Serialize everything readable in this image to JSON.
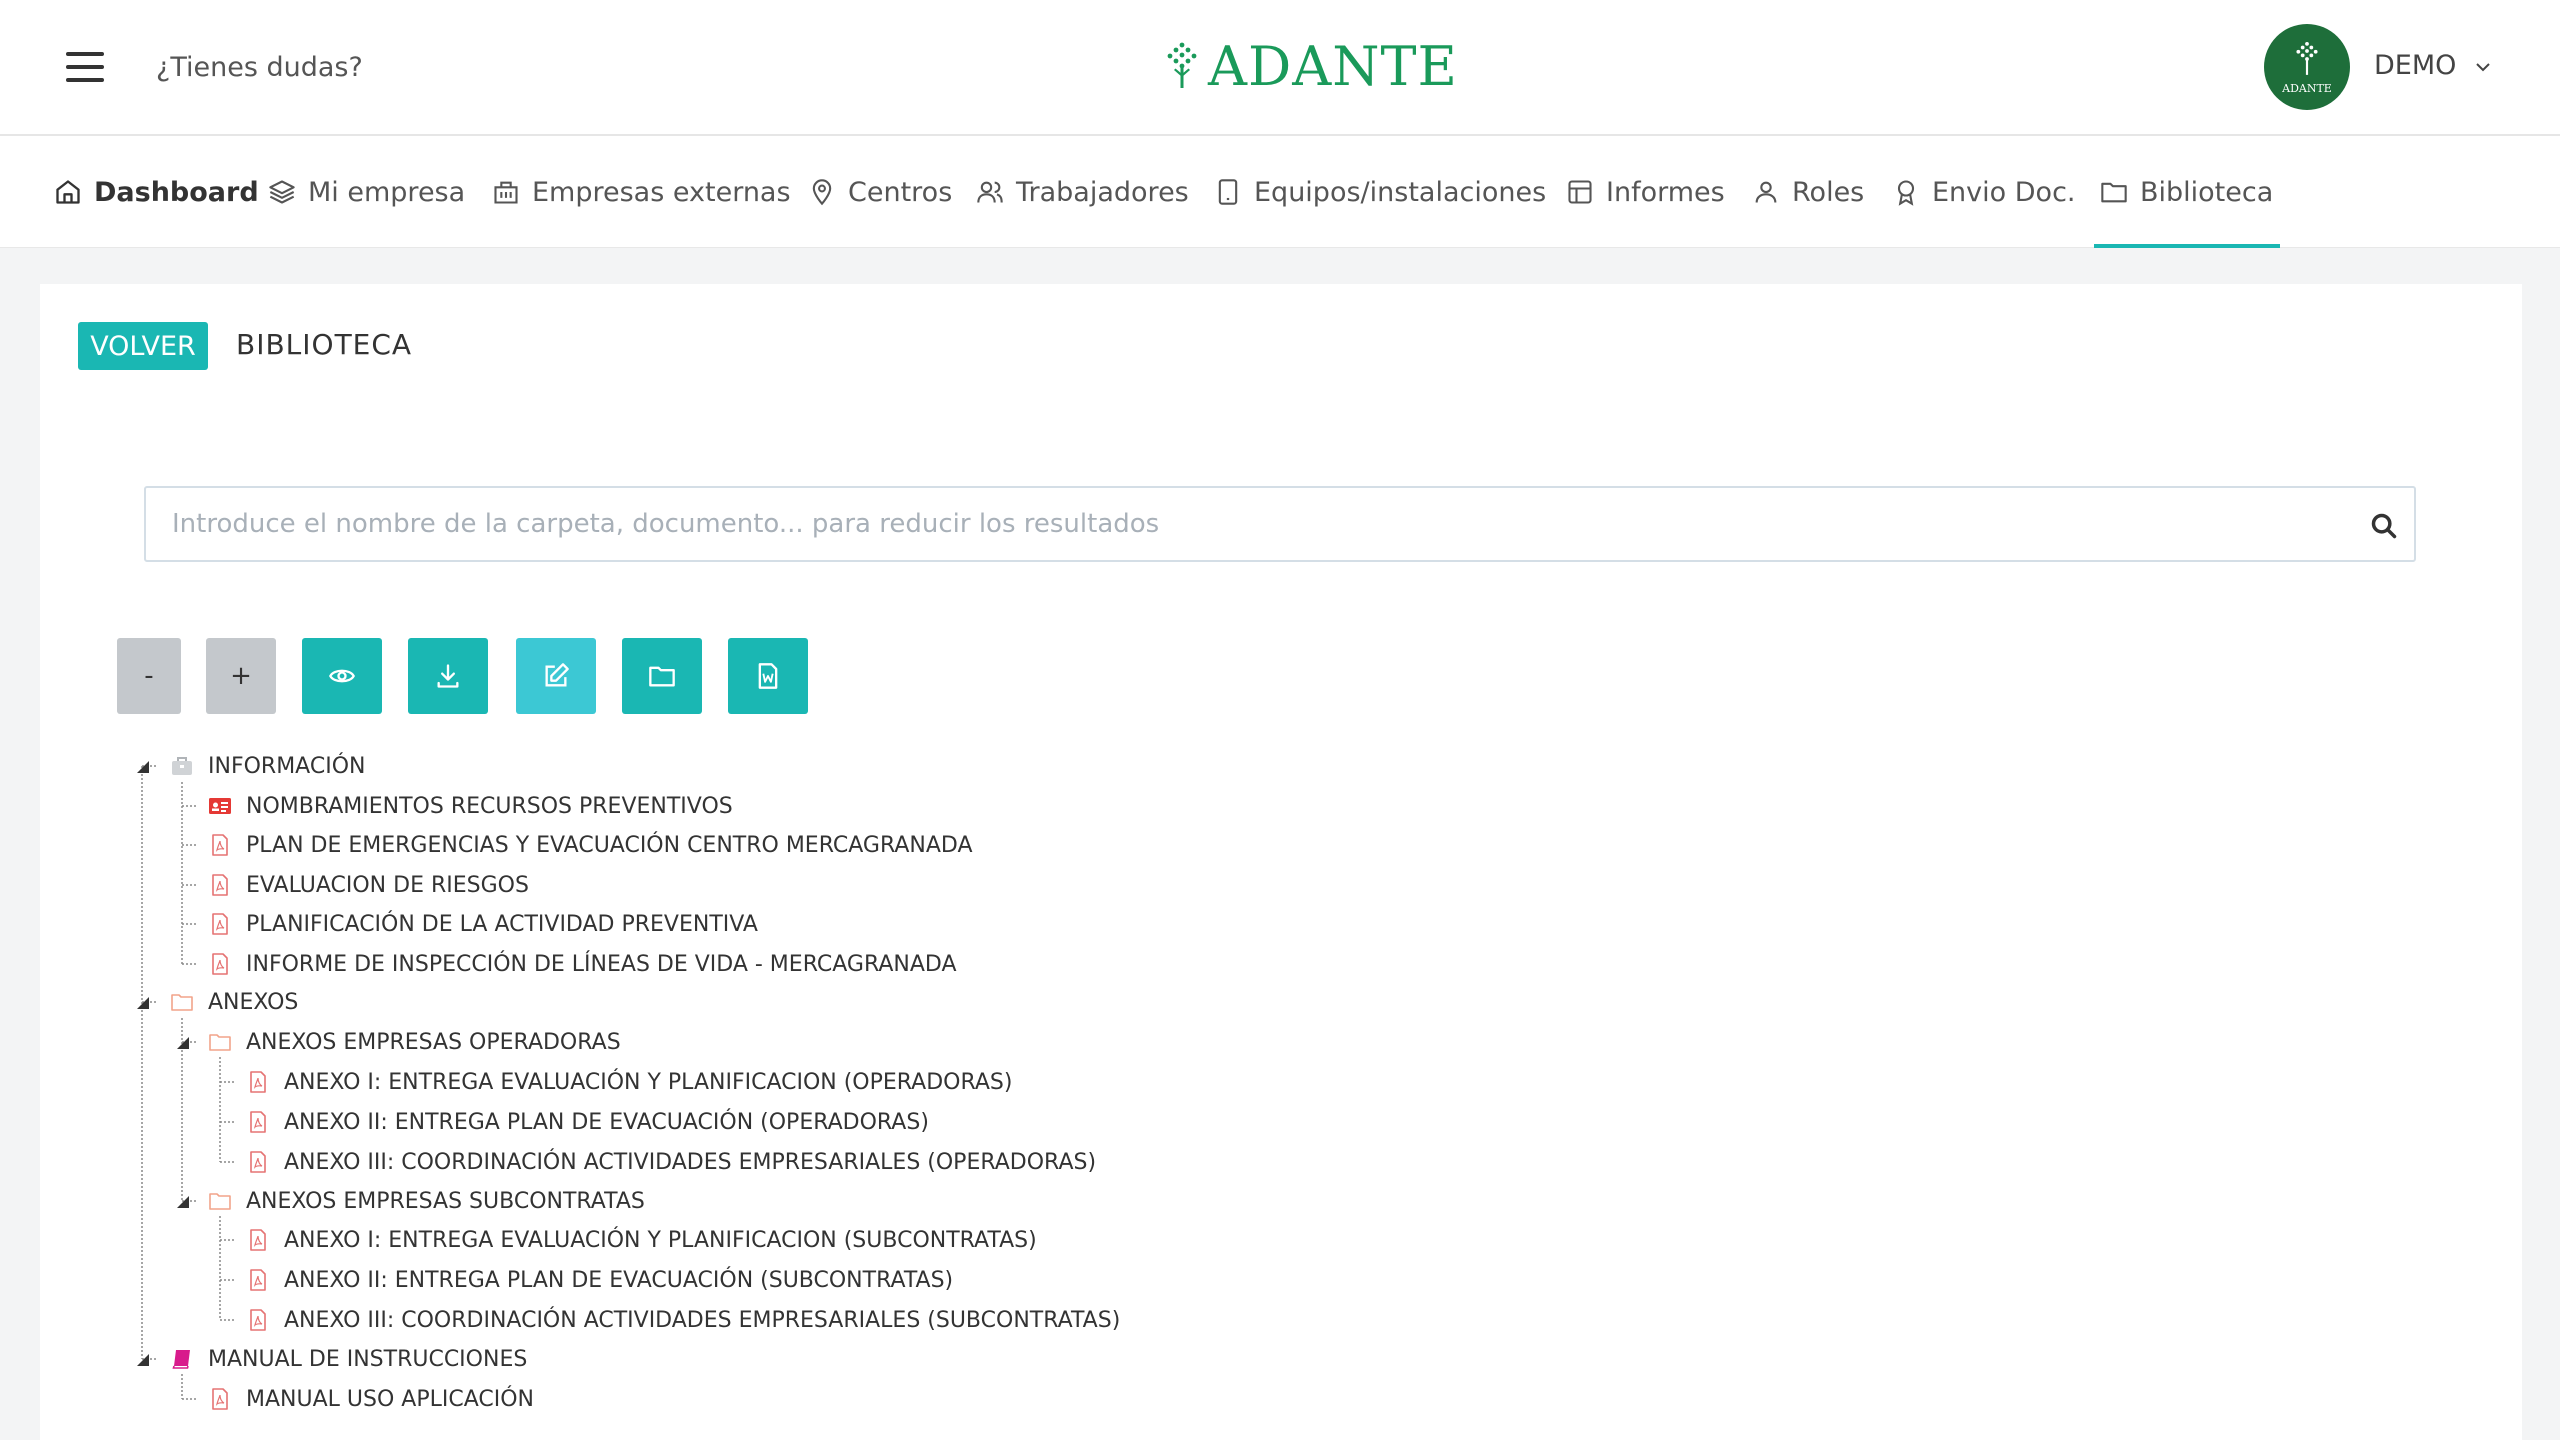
{
  "header": {
    "help_link": "¿Tienes dudas?",
    "logo_text": "ADANTE",
    "avatar_text": "ADANTE",
    "user_name": "DEMO"
  },
  "nav": {
    "items": [
      {
        "label": "Dashboard",
        "icon": "home-icon"
      },
      {
        "label": "Mi empresa",
        "icon": "layers-icon"
      },
      {
        "label": "Empresas externas",
        "icon": "building-icon"
      },
      {
        "label": "Centros",
        "icon": "map-pin-icon"
      },
      {
        "label": "Trabajadores",
        "icon": "users-icon"
      },
      {
        "label": "Equipos/instalaciones",
        "icon": "tablet-icon"
      },
      {
        "label": "Informes",
        "icon": "layout-icon"
      },
      {
        "label": "Roles",
        "icon": "user-icon"
      },
      {
        "label": "Envio Doc.",
        "icon": "award-icon"
      },
      {
        "label": "Biblioteca",
        "icon": "folder-icon"
      }
    ],
    "active": "Biblioteca"
  },
  "page": {
    "back_label": "VOLVER",
    "title": "BIBLIOTECA"
  },
  "search": {
    "placeholder": "Introduce el nombre de la carpeta, documento... para reducir los resultados"
  },
  "toolbar": {
    "collapse_label": "-",
    "expand_label": "+",
    "buttons": [
      "eye-icon",
      "download-icon",
      "edit-icon",
      "folder-icon",
      "word-doc-icon"
    ]
  },
  "tree": [
    {
      "label": "INFORMACIÓN",
      "icon": "briefcase-icon",
      "level": 0
    },
    {
      "label": "NOMBRAMIENTOS RECURSOS PREVENTIVOS",
      "icon": "id-card-icon",
      "level": 1
    },
    {
      "label": "PLAN DE EMERGENCIAS Y EVACUACIÓN CENTRO MERCAGRANADA",
      "icon": "pdf-icon",
      "level": 1
    },
    {
      "label": "EVALUACION DE RIESGOS",
      "icon": "pdf-icon",
      "level": 1
    },
    {
      "label": "PLANIFICACIÓN DE LA ACTIVIDAD PREVENTIVA",
      "icon": "pdf-icon",
      "level": 1
    },
    {
      "label": "INFORME DE INSPECCIÓN DE LÍNEAS DE VIDA - MERCAGRANADA",
      "icon": "pdf-icon",
      "level": 1
    },
    {
      "label": "ANEXOS",
      "icon": "folder-icon",
      "level": 0
    },
    {
      "label": "ANEXOS EMPRESAS OPERADORAS",
      "icon": "folder-icon",
      "level": 1
    },
    {
      "label": "ANEXO I: ENTREGA EVALUACIÓN Y PLANIFICACION (OPERADORAS)",
      "icon": "pdf-icon",
      "level": 2
    },
    {
      "label": "ANEXO II: ENTREGA PLAN DE EVACUACIÓN (OPERADORAS)",
      "icon": "pdf-icon",
      "level": 2
    },
    {
      "label": "ANEXO III: COORDINACIÓN ACTIVIDADES EMPRESARIALES (OPERADORAS)",
      "icon": "pdf-icon",
      "level": 2
    },
    {
      "label": "ANEXOS EMPRESAS SUBCONTRATAS",
      "icon": "folder-icon",
      "level": 1
    },
    {
      "label": "ANEXO I: ENTREGA EVALUACIÓN Y PLANIFICACION (SUBCONTRATAS)",
      "icon": "pdf-icon",
      "level": 2
    },
    {
      "label": "ANEXO II: ENTREGA PLAN DE EVACUACIÓN (SUBCONTRATAS)",
      "icon": "pdf-icon",
      "level": 2
    },
    {
      "label": "ANEXO III: COORDINACIÓN ACTIVIDADES EMPRESARIALES (SUBCONTRATAS)",
      "icon": "pdf-icon",
      "level": 2
    },
    {
      "label": "MANUAL DE INSTRUCCIONES",
      "icon": "book-icon",
      "level": 0
    },
    {
      "label": "MANUAL USO APLICACIÓN",
      "icon": "pdf-icon",
      "level": 1
    }
  ],
  "colors": {
    "accent": "#1ab7b3",
    "accent_light": "#3cc8d4",
    "brand_green": "#1a9a5a",
    "avatar_bg": "#1e6e3a",
    "pdf_red": "#e57373",
    "folder_orange": "#f2a48a",
    "book_magenta": "#d81b8c"
  }
}
